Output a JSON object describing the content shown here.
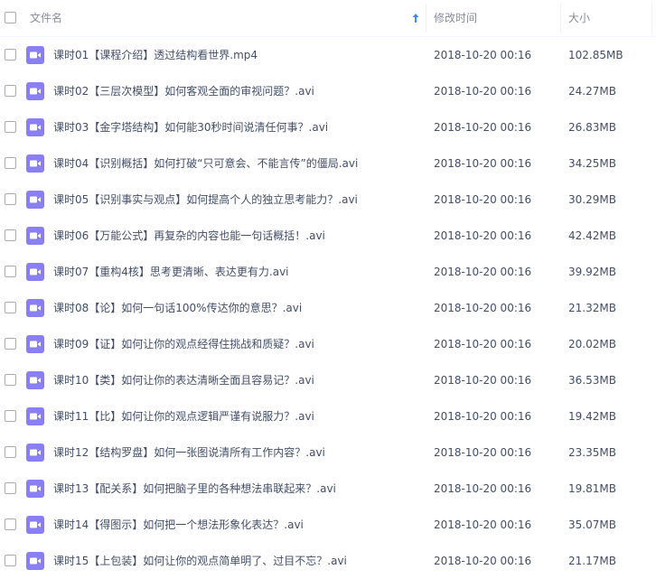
{
  "header": {
    "name_label": "文件名",
    "time_label": "修改时间",
    "size_label": "大小",
    "sort_icon": "arrow-up-icon"
  },
  "colors": {
    "video_icon": "#8a7ef5",
    "text": "#424e67",
    "header_text": "#878c9c",
    "sort_arrow": "#3f8ef7"
  },
  "files": [
    {
      "name": "课时01【课程介绍】透过结构看世界.mp4",
      "time": "2018-10-20 00:16",
      "size": "102.85MB",
      "icon": "video-file-icon"
    },
    {
      "name": "课时02【三层次模型】如何客观全面的审视问题？.avi",
      "time": "2018-10-20 00:16",
      "size": "24.27MB",
      "icon": "video-file-icon"
    },
    {
      "name": "课时03【金字塔结构】如何能30秒时间说清任何事？.avi",
      "time": "2018-10-20 00:16",
      "size": "26.83MB",
      "icon": "video-file-icon"
    },
    {
      "name": "课时04【识别概括】如何打破“只可意会、不能言传”的僵局.avi",
      "time": "2018-10-20 00:16",
      "size": "34.25MB",
      "icon": "video-file-icon"
    },
    {
      "name": "课时05【识别事实与观点】如何提高个人的独立思考能力？.avi",
      "time": "2018-10-20 00:16",
      "size": "30.29MB",
      "icon": "video-file-icon"
    },
    {
      "name": "课时06【万能公式】再复杂的内容也能一句话概括！.avi",
      "time": "2018-10-20 00:16",
      "size": "42.42MB",
      "icon": "video-file-icon"
    },
    {
      "name": "课时07【重构4核】思考更清晰、表达更有力.avi",
      "time": "2018-10-20 00:16",
      "size": "39.92MB",
      "icon": "video-file-icon"
    },
    {
      "name": "课时08【论】如何一句话100%传达你的意思？.avi",
      "time": "2018-10-20 00:16",
      "size": "21.32MB",
      "icon": "video-file-icon"
    },
    {
      "name": "课时09【证】如何让你的观点经得住挑战和质疑？.avi",
      "time": "2018-10-20 00:16",
      "size": "20.02MB",
      "icon": "video-file-icon"
    },
    {
      "name": "课时10【类】如何让你的表达清晰全面且容易记？.avi",
      "time": "2018-10-20 00:16",
      "size": "36.53MB",
      "icon": "video-file-icon"
    },
    {
      "name": "课时11【比】如何让你的观点逻辑严谨有说服力？.avi",
      "time": "2018-10-20 00:16",
      "size": "19.42MB",
      "icon": "video-file-icon"
    },
    {
      "name": "课时12【结构罗盘】如何一张图说清所有工作内容？.avi",
      "time": "2018-10-20 00:16",
      "size": "23.35MB",
      "icon": "video-file-icon"
    },
    {
      "name": "课时13【配关系】如何把脑子里的各种想法串联起来？.avi",
      "time": "2018-10-20 00:16",
      "size": "19.81MB",
      "icon": "video-file-icon"
    },
    {
      "name": "课时14【得图示】如何把一个想法形象化表达？.avi",
      "time": "2018-10-20 00:16",
      "size": "35.07MB",
      "icon": "video-file-icon"
    },
    {
      "name": "课时15【上包装】如何让你的观点简单明了、过目不忘？.avi",
      "time": "2018-10-20 00:16",
      "size": "21.17MB",
      "icon": "video-file-icon"
    }
  ]
}
